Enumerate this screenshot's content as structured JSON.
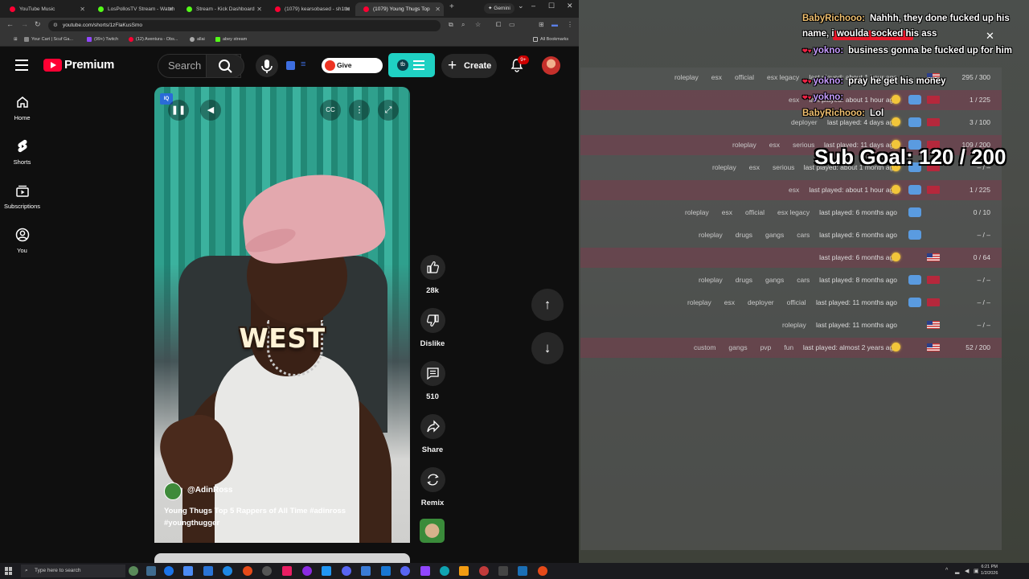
{
  "browser": {
    "tabs": [
      {
        "title": "YouTube Music",
        "color": "#ff0033"
      },
      {
        "title": "LosPollosTV Stream - Watch",
        "color": "#53fc18"
      },
      {
        "title": "Stream - Kick Dashboard",
        "color": "#53fc18"
      },
      {
        "title": "(1079) kearsobased - sh1tlo",
        "color": "#ff0033"
      },
      {
        "title": "(1079) Young Thugs Top",
        "color": "#ff0033"
      }
    ],
    "gemini_label": "Gemini",
    "url": "youtube.com/shorts/1zFlaKusSmo",
    "bookmarks": [
      {
        "label": "Your Cart | Scuf Ga...",
        "color": "#888888"
      },
      {
        "label": "(99+) Twitch",
        "color": "#9146ff"
      },
      {
        "label": "(12) Aventura - Obs...",
        "color": "#ff0033"
      },
      {
        "label": "allai",
        "color": "#aaaaaa"
      },
      {
        "label": "abey stream",
        "color": "#53fc18"
      }
    ],
    "all_bookmarks": "All Bookmarks"
  },
  "youtube": {
    "logo_text": "Premium",
    "search_placeholder": "Search",
    "feedback_label": "Give feedback",
    "create_label": "Create",
    "notif_badge": "9+",
    "nav": [
      {
        "label": "Home",
        "icon": "home-icon"
      },
      {
        "label": "Shorts",
        "icon": "shorts-icon"
      },
      {
        "label": "Subscriptions",
        "icon": "subscriptions-icon"
      },
      {
        "label": "You",
        "icon": "you-icon"
      }
    ],
    "short": {
      "caption_word": "WEST",
      "channel": "@AdinRoss",
      "title": "Young Thugs Top 5 Rappers of All Time #adinross #youngthugger",
      "iq_badge": "IQ"
    },
    "actions": {
      "likes": "28k",
      "dislike": "Dislike",
      "comments": "510",
      "share": "Share",
      "remix": "Remix"
    }
  },
  "overlay": {
    "chat": [
      {
        "user": "BabyRichooo:",
        "user_color": "#f0c070",
        "msg": "Nahhh, they done fucked up his name, i woulda socked his ass",
        "hearts": false
      },
      {
        "user": "yokno:",
        "user_color": "#c79cff",
        "msg": "business gonna be fucked up for him",
        "hearts": true
      },
      {
        "user": "yokno:",
        "user_color": "#c79cff",
        "msg": "pray he get his money",
        "hearts": true
      },
      {
        "user": "yokno:",
        "user_color": "#c79cff",
        "msg": "",
        "hearts": true
      },
      {
        "user": "BabyRichooo:",
        "user_color": "#f0c070",
        "msg": "Lol",
        "hearts": false
      }
    ],
    "sub_goal": "Sub Goal:  120 / 200",
    "servers": [
      {
        "tags": [
          "roleplay",
          "esx",
          "official",
          "esx legacy"
        ],
        "last": "last played: about 1 hour ago",
        "sun": false,
        "discord": false,
        "flag": "us",
        "slots": "295 / 300",
        "hl": false
      },
      {
        "tags": [
          "esx"
        ],
        "last": "last played: about 1 hour ago",
        "sun": true,
        "discord": true,
        "flag": "red",
        "slots": "1 / 225",
        "hl": true
      },
      {
        "tags": [
          "deployer"
        ],
        "last": "last played: 4 days ago",
        "sun": true,
        "discord": true,
        "flag": "red",
        "slots": "3 / 100",
        "hl": false
      },
      {
        "tags": [
          "roleplay",
          "esx",
          "serious"
        ],
        "last": "last played: 11 days ago",
        "sun": true,
        "discord": true,
        "flag": "red",
        "slots": "109 / 200",
        "hl": true
      },
      {
        "tags": [
          "roleplay",
          "esx",
          "serious"
        ],
        "last": "last played: about 1 month ago",
        "sun": true,
        "discord": true,
        "flag": "red",
        "slots": "– / –",
        "hl": false
      },
      {
        "tags": [
          "esx"
        ],
        "last": "last played: about 1 hour ago",
        "sun": true,
        "discord": true,
        "flag": "red",
        "slots": "1 / 225",
        "hl": true
      },
      {
        "tags": [
          "roleplay",
          "esx",
          "official",
          "esx legacy"
        ],
        "last": "last played: 6 months ago",
        "sun": false,
        "discord": true,
        "flag": "",
        "slots": "0 / 10",
        "hl": false
      },
      {
        "tags": [
          "roleplay",
          "drugs",
          "gangs",
          "cars"
        ],
        "last": "last played: 6 months ago",
        "sun": false,
        "discord": true,
        "flag": "",
        "slots": "– / –",
        "hl": false
      },
      {
        "tags": [],
        "last": "last played: 6 months ago",
        "sun": true,
        "discord": false,
        "flag": "us",
        "slots": "0 / 64",
        "hl": true
      },
      {
        "tags": [
          "roleplay",
          "drugs",
          "gangs",
          "cars"
        ],
        "last": "last played: 8 months ago",
        "sun": false,
        "discord": true,
        "flag": "red",
        "slots": "– / –",
        "hl": false
      },
      {
        "tags": [
          "roleplay",
          "esx",
          "deployer",
          "official"
        ],
        "last": "last played: 11 months ago",
        "sun": false,
        "discord": true,
        "flag": "red",
        "slots": "– / –",
        "hl": false
      },
      {
        "tags": [
          "roleplay"
        ],
        "last": "last played: 11 months ago",
        "sun": false,
        "discord": false,
        "flag": "us",
        "slots": "– / –",
        "hl": false
      },
      {
        "tags": [
          "custom",
          "gangs",
          "pvp",
          "fun"
        ],
        "last": "last played: almost 2 years ago",
        "sun": true,
        "discord": false,
        "flag": "us",
        "slots": "52 / 200",
        "hl": true
      }
    ]
  },
  "taskbar": {
    "search_placeholder": "Type here to search",
    "time": "6:21 PM",
    "date": "1/2/2026"
  }
}
